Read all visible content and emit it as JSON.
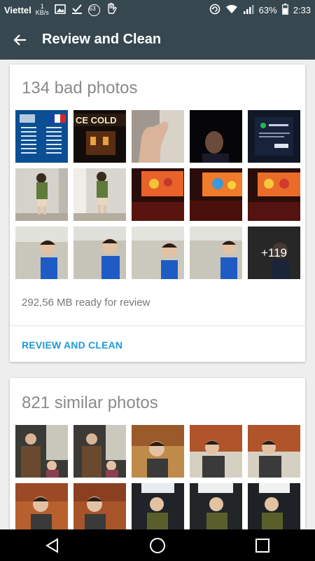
{
  "status_bar": {
    "carrier": "Viettel",
    "net_speed": "1",
    "net_unit": "KB/s",
    "notification_count": "63",
    "battery": "63%",
    "time": "2:33"
  },
  "app_bar": {
    "title": "Review and Clean",
    "back_icon": "arrow-left-icon"
  },
  "bad_photos": {
    "title": "134 bad photos",
    "more_count": "+119",
    "info": "292,56 MB ready for review",
    "action": "REVIEW AND CLEAN"
  },
  "similar_photos": {
    "title": "821 similar photos"
  },
  "nav_bar": {
    "back_icon": "triangle-back-icon",
    "home_icon": "circle-home-icon",
    "recents_icon": "square-recents-icon"
  },
  "colors": {
    "bars": "#37474f",
    "accent": "#1e9ad6",
    "title_gray": "#8a8a8a"
  }
}
